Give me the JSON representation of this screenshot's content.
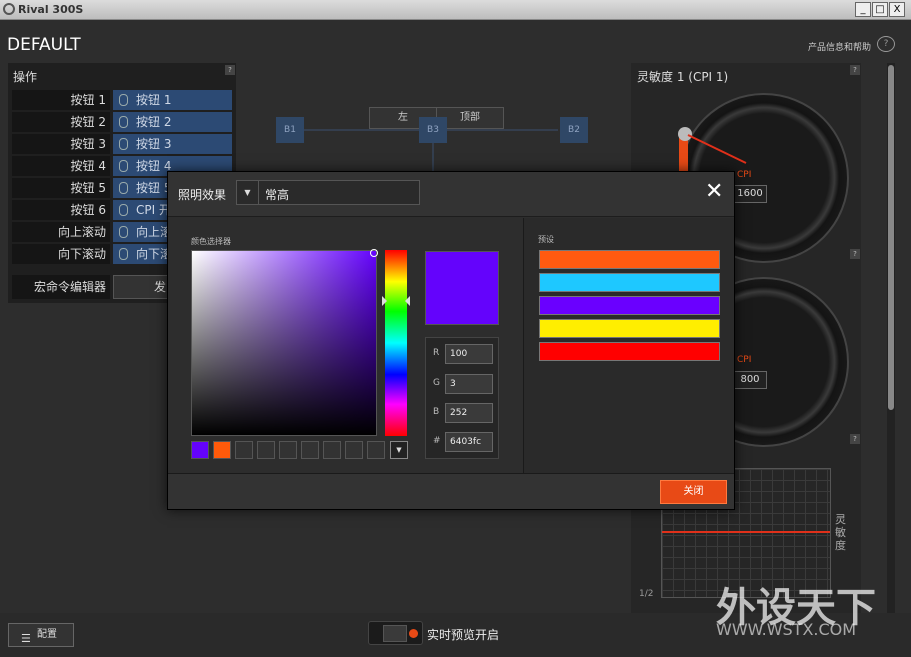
{
  "window": {
    "title": "Rival 300S",
    "min": "_",
    "max": "□",
    "close": "X"
  },
  "header": {
    "profile": "DEFAULT",
    "help_link": "产品信息和帮助",
    "help_icon": "?"
  },
  "actions": {
    "title": "操作",
    "help": "?",
    "rows": [
      {
        "key": "按钮 1",
        "val": "按钮 1"
      },
      {
        "key": "按钮 2",
        "val": "按钮 2"
      },
      {
        "key": "按钮 3",
        "val": "按钮 3"
      },
      {
        "key": "按钮 4",
        "val": "按钮 4"
      },
      {
        "key": "按钮 5",
        "val": "按钮 5"
      },
      {
        "key": "按钮 6",
        "val": "CPI 开"
      },
      {
        "key": "向上滚动",
        "val": "向上滚"
      },
      {
        "key": "向下滚动",
        "val": "向下滚"
      }
    ],
    "macro_key": "宏命令编辑器",
    "macro_val": "发"
  },
  "center": {
    "tab_left": "左",
    "tab_top": "顶部",
    "b1": "B1",
    "b2": "B2",
    "b3": "B3"
  },
  "sensitivity": {
    "title": "灵敏度 1 (CPI 1)",
    "help": "?",
    "cpi_label": "CPI",
    "val1": "1600",
    "val2": "800",
    "help2": "?",
    "help3": "?",
    "axis": "灵敏度",
    "page": "1/2"
  },
  "bottom": {
    "config": "配置",
    "preview": "实时预览开启"
  },
  "modal": {
    "label": "照明效果",
    "effect": "常高",
    "close_x": "✕",
    "picker_label": "颜色选择器",
    "presets_label": "预设",
    "r_label": "R",
    "r": "100",
    "g_label": "G",
    "g": "3",
    "b_label": "B",
    "b": "252",
    "hex_label": "#",
    "hex": "6403fc",
    "dropdown": "▼",
    "close_btn": "关闭",
    "color": "#6403fc",
    "swatches": [
      "#6403fc",
      "#ff5a0a",
      "",
      "",
      "",
      "",
      "",
      "",
      ""
    ],
    "presets": [
      "#ff5a10",
      "#1ec8ff",
      "#6a00ff",
      "#ffee00",
      "#ff0000"
    ]
  },
  "watermark": {
    "main": "外设天下",
    "sub": "WWW.WSTX.COM"
  }
}
